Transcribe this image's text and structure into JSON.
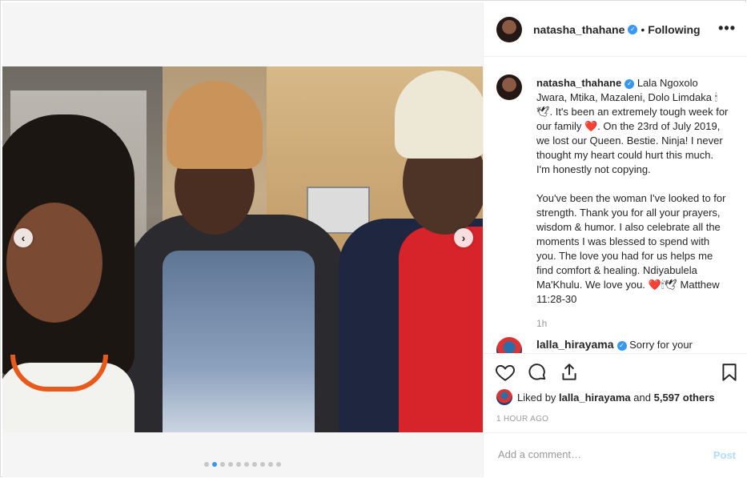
{
  "post": {
    "username": "natasha_thahane",
    "follow_separator": "•",
    "following_label": "Following",
    "more_label": "•••"
  },
  "caption": {
    "username": "natasha_thahane",
    "text": "Lala Ngoxolo Jwara, Mtika, Mazaleni, Dolo Limdaka 🕯🕊. It's been an extremely tough week for our family ❤️. On the 23rd of July 2019, we lost our Queen. Bestie. Ninja! I never thought my heart could hurt this much. I'm honestly not copying.\n\nYou've been the woman I've looked to for strength. Thank you for all your prayers, wisdom & humor. I also celebrate all the moments I was blessed to spend with you. The love you had for us helps me find comfort & healing. Ndiyabulela Ma'Khulu. We love you. ❤️🕯🕊 Matthew 11:28-30",
    "time_ago": "1h"
  },
  "comment": {
    "username": "lalla_hirayama",
    "text": "Sorry for your"
  },
  "likes": {
    "prefix": "Liked by",
    "user": "lalla_hirayama",
    "conjunction": "and",
    "others": "5,597 others"
  },
  "posted_time": "1 HOUR AGO",
  "comment_box": {
    "placeholder": "Add a comment…",
    "post_label": "Post"
  },
  "carousel": {
    "prev": "‹",
    "next": "›"
  },
  "colors": {
    "accent": "#3897f0",
    "post_disabled": "#b3dbff",
    "heart_red": "#ed4956"
  },
  "icons": [
    "like-icon",
    "comment-icon",
    "share-icon",
    "bookmark-icon",
    "more-options-icon",
    "verified-badge-icon"
  ]
}
